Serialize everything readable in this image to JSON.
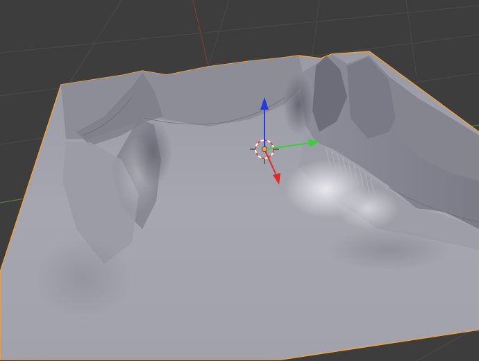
{
  "viewport": {
    "mode": "3d-viewport",
    "background_color": "#3d3d3d",
    "grid_color": "#4a4a4a",
    "x_axis_line_color": "#8a3a3a",
    "y_axis_line_color": "#5a8a3a"
  },
  "object": {
    "type": "terrain-mesh",
    "selected": true,
    "selection_outline_color": "#f2a03c",
    "surface_color": "#a8a8b2",
    "shade_color": "#6e6e7a",
    "highlight_color": "#e4e4e8"
  },
  "gizmo": {
    "type": "translate",
    "x_axis_color": "#e02828",
    "y_axis_color": "#38d238",
    "z_axis_color": "#2838e0",
    "origin_color": "#f0a050",
    "cursor_ring_color": "#ffffff",
    "cursor_dash_color": "#e04040"
  }
}
